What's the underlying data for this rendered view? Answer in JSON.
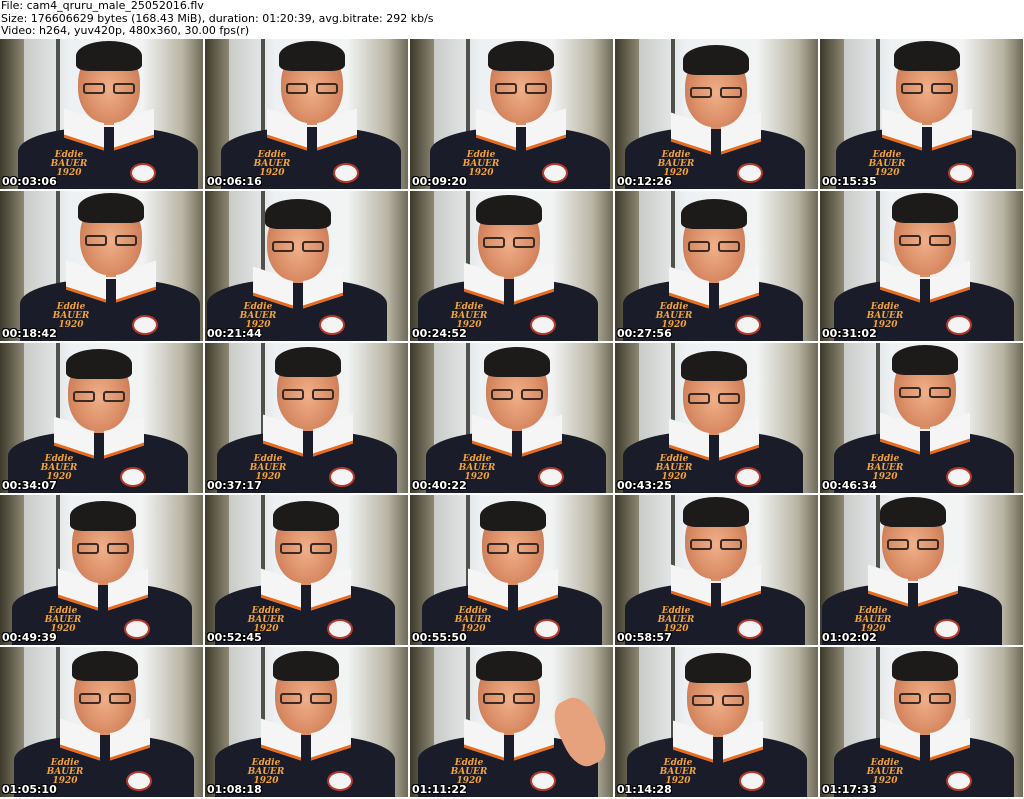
{
  "header": {
    "line1": "File: cam4_qruru_male_25052016.flv",
    "line2": "Size: 176606629 bytes (168.43 MiB), duration: 01:20:39, avg.bitrate: 292 kb/s",
    "line3": "Video: h264, yuv420p, 480x360, 30.00 fps(r)"
  },
  "shirt_text": {
    "brand_line1": "Eddie",
    "brand_line2": "BAUER",
    "brand_line3": "1920"
  },
  "thumbnails": [
    {
      "timestamp": "00:03:06"
    },
    {
      "timestamp": "00:06:16"
    },
    {
      "timestamp": "00:09:20"
    },
    {
      "timestamp": "00:12:26"
    },
    {
      "timestamp": "00:15:35"
    },
    {
      "timestamp": "00:18:42"
    },
    {
      "timestamp": "00:21:44"
    },
    {
      "timestamp": "00:24:52"
    },
    {
      "timestamp": "00:27:56"
    },
    {
      "timestamp": "00:31:02"
    },
    {
      "timestamp": "00:34:07"
    },
    {
      "timestamp": "00:37:17"
    },
    {
      "timestamp": "00:40:22"
    },
    {
      "timestamp": "00:43:25"
    },
    {
      "timestamp": "00:46:34"
    },
    {
      "timestamp": "00:49:39"
    },
    {
      "timestamp": "00:52:45"
    },
    {
      "timestamp": "00:55:50"
    },
    {
      "timestamp": "00:58:57"
    },
    {
      "timestamp": "01:02:02"
    },
    {
      "timestamp": "01:05:10"
    },
    {
      "timestamp": "01:08:18"
    },
    {
      "timestamp": "01:11:22"
    },
    {
      "timestamp": "01:14:28"
    },
    {
      "timestamp": "01:17:33"
    }
  ]
}
